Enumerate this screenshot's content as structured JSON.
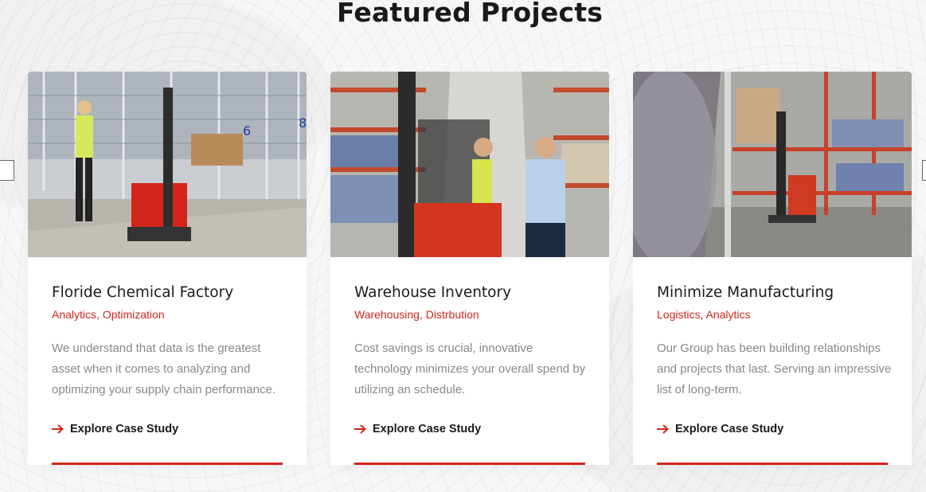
{
  "section": {
    "title": "Featured Projects"
  },
  "accent_color": "#d3251b",
  "cards": [
    {
      "title": "Floride Chemical Factory",
      "tags": [
        "Analytics",
        "Optimization"
      ],
      "description": "We understand that data is the greatest asset when it comes to analyzing and optimizing your supply chain performance.",
      "link_label": "Explore Case Study",
      "image_icon": "warehouse-photo-icon"
    },
    {
      "title": "Warehouse Inventory",
      "tags": [
        "Warehousing",
        "Distrbution"
      ],
      "description": "Cost savings is crucial, innovative technology minimizes your overall spend by utilizing an schedule.",
      "link_label": "Explore Case Study",
      "image_icon": "forklift-photo-icon"
    },
    {
      "title": "Minimize Manufacturing",
      "tags": [
        "Logistics",
        "Analytics"
      ],
      "description": "Our Group has been building relationships and projects that last. Serving an impressive list of long-term.",
      "link_label": "Explore Case Study",
      "image_icon": "pallet-rack-photo-icon"
    }
  ]
}
